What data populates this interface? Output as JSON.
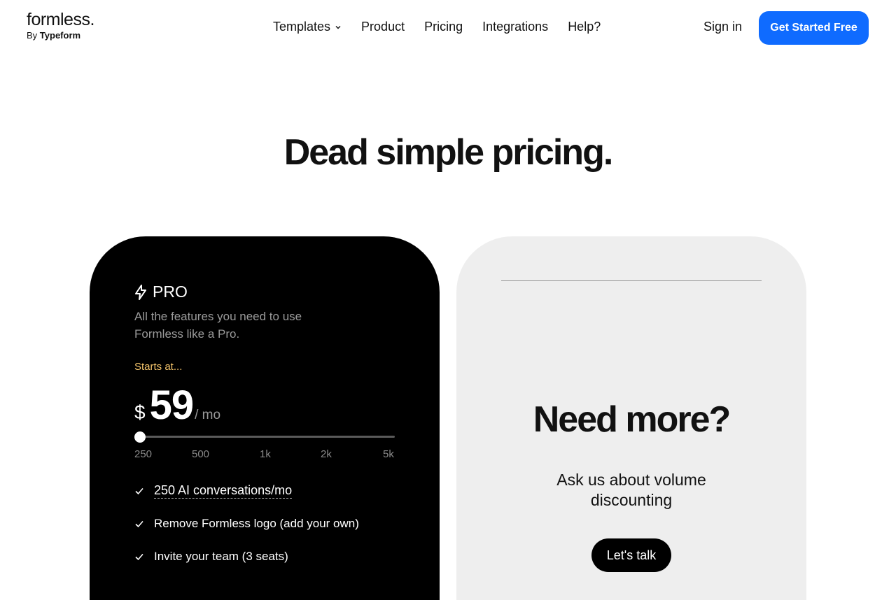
{
  "header": {
    "logo": {
      "wordmark": "formless.",
      "by": "By",
      "brand": "Typeform"
    },
    "nav": [
      {
        "label": "Templates",
        "has_dropdown": true
      },
      {
        "label": "Product"
      },
      {
        "label": "Pricing"
      },
      {
        "label": "Integrations"
      },
      {
        "label": "Help?"
      }
    ],
    "sign_in": "Sign in",
    "cta": "Get Started Free"
  },
  "hero": {
    "title": "Dead simple pricing."
  },
  "pro": {
    "icon": "lightning-icon",
    "name": "PRO",
    "description": "All the features you need to use Formless like a Pro.",
    "starts_at": "Starts at...",
    "currency": "$",
    "price": "59",
    "period": "/ mo",
    "slider": {
      "selected": "250",
      "ticks": [
        "250",
        "500",
        "1k",
        "2k",
        "5k"
      ]
    },
    "features": [
      "250 AI conversations/mo",
      "Remove Formless logo (add your own)",
      "Invite your team (3 seats)"
    ]
  },
  "enterprise": {
    "title": "Need more?",
    "description": "Ask us about volume discounting",
    "button": "Let's talk"
  },
  "colors": {
    "accent": "#0f6bff",
    "pro_card": "#000000",
    "enterprise_card": "#eeeeee",
    "starts_highlight": "#f5c56b"
  }
}
